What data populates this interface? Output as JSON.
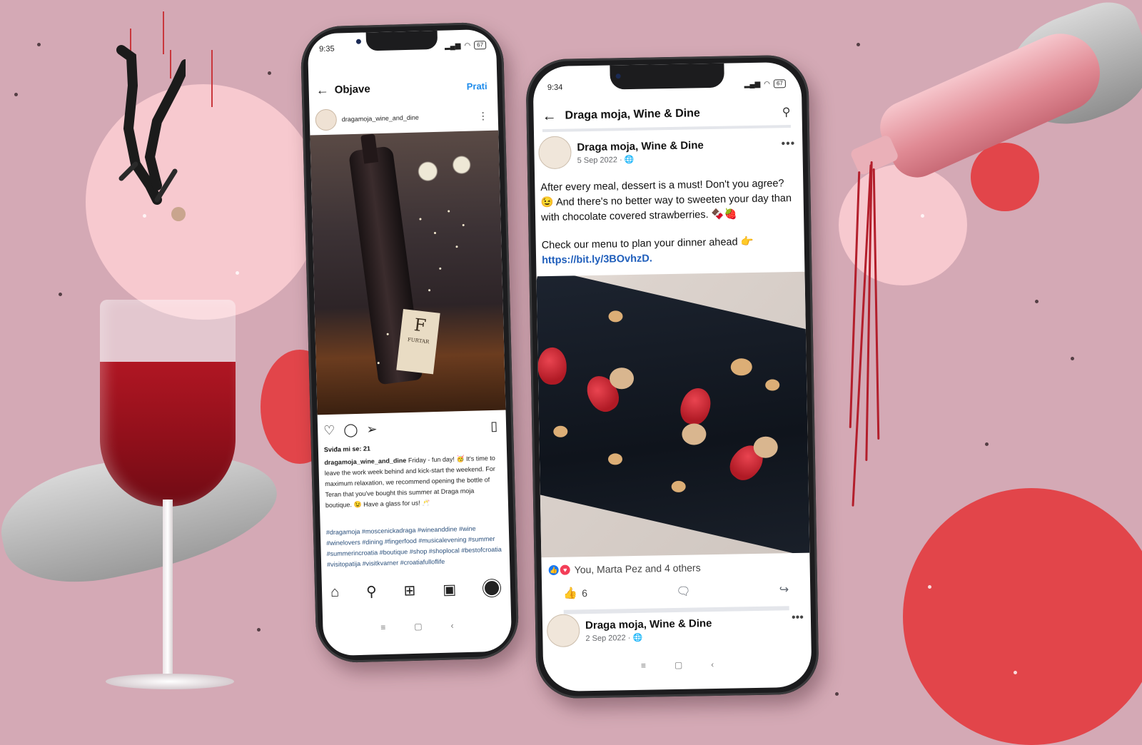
{
  "instagram": {
    "status_time": "9:35",
    "battery": "67",
    "header_title": "Objave",
    "follow_label": "Prati",
    "username": "dragamoja_wine_and_dine",
    "photo_tag_letter": "F",
    "photo_tag_brand": "FURTAR",
    "likes": "Sviđa mi se: 21",
    "caption_user": "dragamoja_wine_and_dine",
    "caption_text": "Friday - fun day! 🥳 It's time to leave the work week behind and kick-start the weekend. For maximum relaxation, we recommend opening the bottle of Teran that you've bought this summer at Draga moja boutique. 😉 Have a glass for us! 🥂",
    "hashtags": "#dragamoja #moscenickadraga #wineanddine #wine #winelovers #dining #fingerfood #musicalevening #summer #summerincroatia #boutique #shop #shoplocal #bestofcroatia #visitopatija #visitkvarner #croatiafulloflife",
    "icons": [
      "heart-icon",
      "comment-icon",
      "send-icon",
      "bookmark-icon",
      "home-icon",
      "search-icon",
      "add-icon",
      "reels-icon",
      "profile-icon"
    ]
  },
  "facebook": {
    "status_time": "9:34",
    "battery": "67",
    "header_title": "Draga moja, Wine & Dine",
    "post": {
      "author": "Draga moja, Wine & Dine",
      "date": "5 Sep 2022 · 🌐",
      "text_line1": "After every meal, dessert is a must! Don't you agree? 😉 And there's no better way to sweeten your day than with chocolate covered strawberries. 🍫🍓",
      "text_line2": "Check our menu to plan your dinner ahead 👉",
      "link": "https://bit.ly/3BOvhzD.",
      "reactions_text": "You, Marta Pez and 4 others",
      "like_count": "6"
    },
    "post2": {
      "author": "Draga moja, Wine & Dine",
      "date": "2 Sep 2022 · 🌐"
    }
  },
  "colors": {
    "background": "#d4a9b5",
    "accent_red": "#e2454a",
    "facebook_blue": "#1877f2",
    "instagram_link": "#1f8ceb"
  }
}
